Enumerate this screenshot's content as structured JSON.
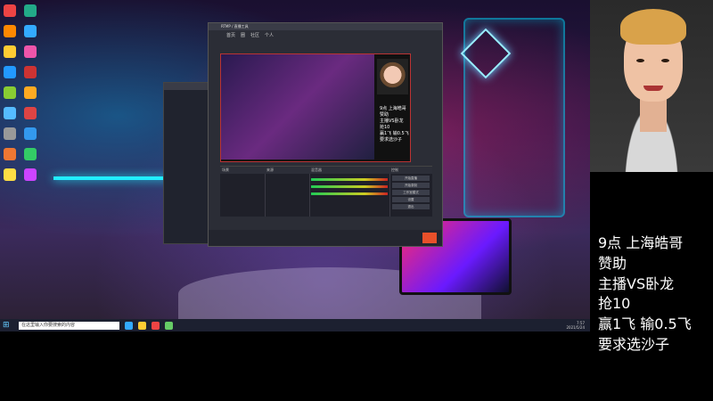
{
  "overlay": {
    "lines": [
      "9点 上海皓哥",
      "赞助",
      "主播VS卧龙",
      "抢10",
      "赢1飞 输0.5飞",
      "要求选沙子"
    ]
  },
  "taskbar": {
    "search_placeholder": "在这里输入你要搜索的内容",
    "start_icon": "windows-icon",
    "time": "7:57",
    "date": "2021/5/24"
  },
  "obs": {
    "title": "RTMP / 直播工具",
    "tabs": [
      "首页",
      "圈",
      "社区",
      "个人"
    ],
    "preview_text": [
      "9点 上海皓哥",
      "赞助",
      "主播VS卧龙",
      "抢10",
      "赢1飞 输0.5飞",
      "要求选沙子"
    ],
    "dock_labels": [
      "场景",
      "来源",
      "混音器",
      "控制"
    ],
    "control_buttons": [
      "开始直播",
      "开始录制",
      "工作室模式",
      "设置",
      "退出"
    ],
    "live_label": "开播"
  },
  "colors": {
    "accent": "#e8502a",
    "neon": "#22eeff",
    "taskbar": "#1c2030"
  }
}
